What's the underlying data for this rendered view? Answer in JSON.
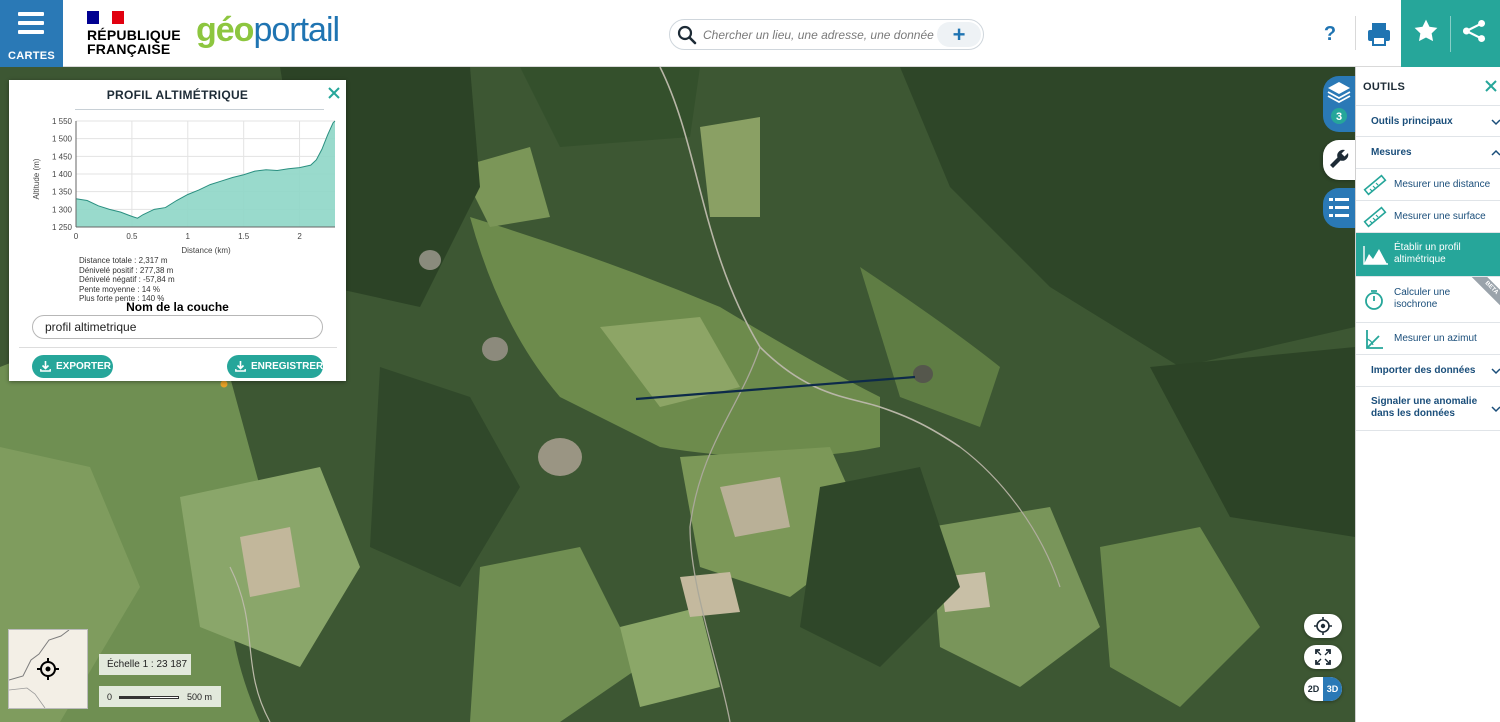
{
  "header": {
    "menu_label": "CARTES",
    "rf_line1": "RÉPUBLIQUE",
    "rf_line2": "FRANÇAISE",
    "logo_geo": "géo",
    "logo_portail": "portail",
    "search_placeholder": "Chercher un lieu, une adresse, une donnée",
    "help_label": "?"
  },
  "colors": {
    "brand_blue": "#2a79b6",
    "teal": "#26a69a",
    "dark_text": "#1a4e7a"
  },
  "layers_badge": "3",
  "profile_panel": {
    "title": "PROFIL ALTIMÉTRIQUE",
    "stats": {
      "total": "Distance totale : 2,317 m",
      "positive": "Dénivelé positif : 277,38 m",
      "negative": "Dénivelé négatif : -57,84 m",
      "avg_slope": "Pente moyenne : 14 %",
      "max_slope": "Plus forte pente : 140 %"
    },
    "layer_label": "Nom de la couche",
    "layer_value": "profil altimetrique",
    "export_label": "EXPORTER",
    "save_label": "ENREGISTRER"
  },
  "chart_data": {
    "type": "area",
    "xlabel": "Distance (km)",
    "ylabel": "Altitude (m)",
    "xlim": [
      0,
      2.317
    ],
    "ylim": [
      1250,
      1550
    ],
    "x_ticks": [
      "0",
      "0.5",
      "1",
      "1.5",
      "2"
    ],
    "y_ticks": [
      "1 250",
      "1 300",
      "1 350",
      "1 400",
      "1 450",
      "1 500",
      "1 550"
    ],
    "grid": true,
    "x": [
      0,
      0.1,
      0.2,
      0.3,
      0.4,
      0.5,
      0.55,
      0.6,
      0.7,
      0.8,
      0.9,
      1.0,
      1.1,
      1.2,
      1.3,
      1.4,
      1.5,
      1.6,
      1.7,
      1.8,
      1.9,
      2.0,
      2.1,
      2.15,
      2.2,
      2.25,
      2.3,
      2.317
    ],
    "y": [
      1330,
      1325,
      1310,
      1300,
      1292,
      1280,
      1275,
      1285,
      1300,
      1305,
      1325,
      1342,
      1355,
      1370,
      1380,
      1390,
      1398,
      1408,
      1412,
      1410,
      1415,
      1418,
      1425,
      1440,
      1470,
      1510,
      1545,
      1550
    ]
  },
  "tools_panel": {
    "title": "OUTILS",
    "sections": [
      {
        "label": "Outils principaux",
        "expanded": false
      },
      {
        "label": "Mesures",
        "expanded": true
      }
    ],
    "items": [
      {
        "label": "Mesurer une distance"
      },
      {
        "label": "Mesurer une surface"
      },
      {
        "label": "Établir un profil altimétrique",
        "active": true
      },
      {
        "label": "Calculer une isochrone",
        "badge": "BETA"
      },
      {
        "label": "Mesurer un azimut"
      }
    ],
    "bottom_sections": [
      {
        "label": "Importer des données"
      },
      {
        "label": "Signaler une anomalie dans les données"
      }
    ]
  },
  "map_controls": {
    "dim_2d": "2D",
    "dim_3d": "3D",
    "scale_text": "Échelle 1 : 23 187",
    "scale_zero": "0",
    "scale_distance": "500 m"
  }
}
